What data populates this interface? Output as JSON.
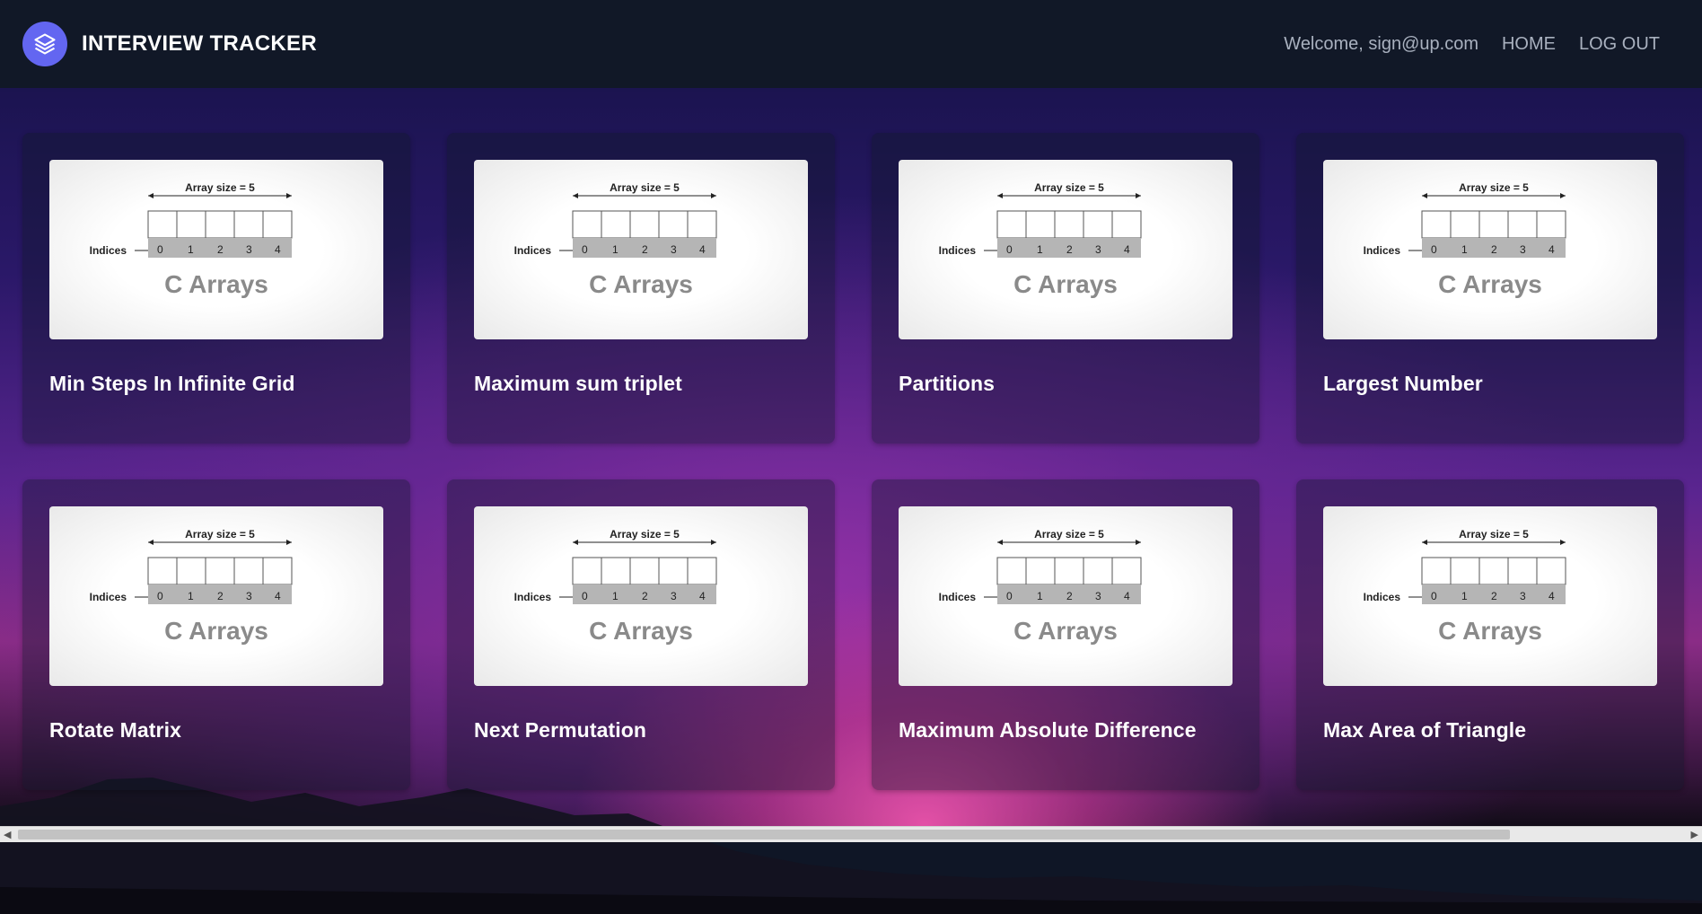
{
  "header": {
    "brand_title": "INTERVIEW TRACKER",
    "logo_icon": "layers-icon",
    "welcome_text": "Welcome, sign@up.com",
    "home_label": "HOME",
    "logout_label": "LOG OUT"
  },
  "thumbnail": {
    "size_label": "Array size = 5",
    "indices_label": "Indices",
    "index_values": [
      "0",
      "1",
      "2",
      "3",
      "4"
    ],
    "caption": "C Arrays"
  },
  "cards": [
    {
      "title": "Min Steps In Infinite Grid"
    },
    {
      "title": "Maximum sum triplet"
    },
    {
      "title": "Partitions"
    },
    {
      "title": "Largest Number"
    },
    {
      "title": "Rotate Matrix"
    },
    {
      "title": "Next Permutation"
    },
    {
      "title": "Maximum Absolute Difference"
    },
    {
      "title": "Max Area of Triangle"
    }
  ],
  "colors": {
    "header_bg": "#111827",
    "logo_bg": "#6366f1",
    "nav_text": "#a9b1bf"
  },
  "scrollbar": {
    "left_arrow_icon": "left-arrow-icon",
    "right_arrow_icon": "right-arrow-icon"
  }
}
